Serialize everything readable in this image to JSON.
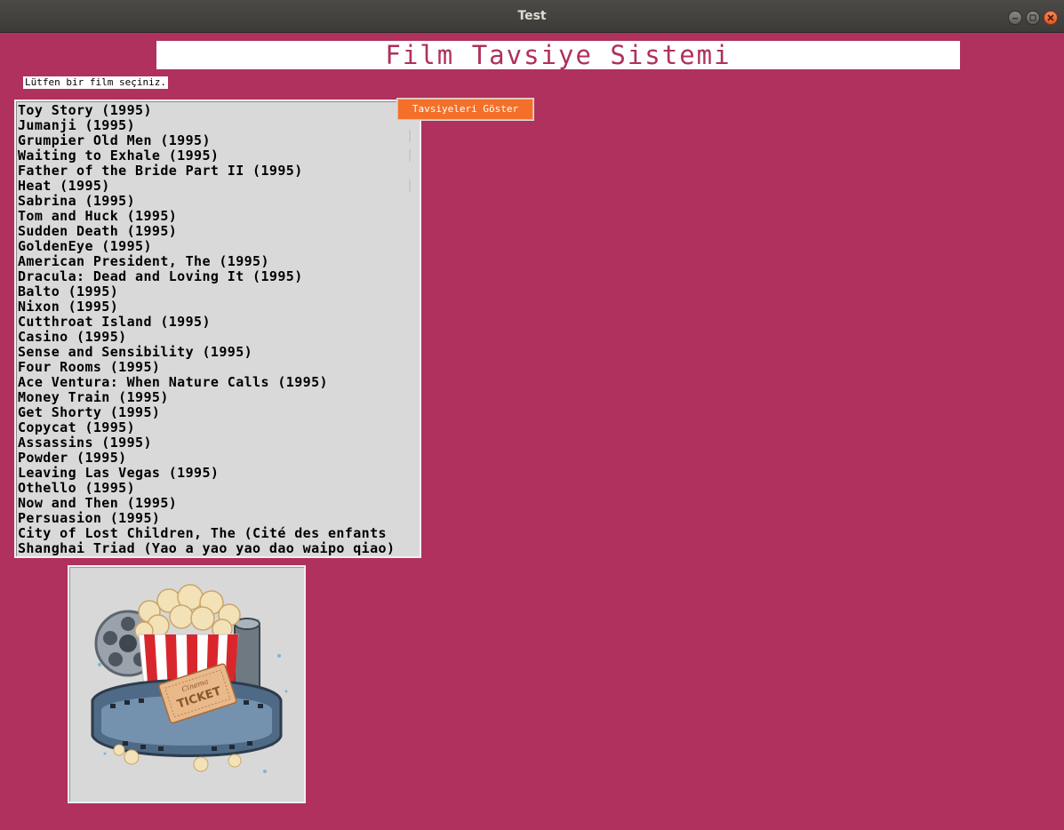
{
  "window": {
    "title": "Test"
  },
  "header": {
    "title": "Film Tavsiye Sistemi"
  },
  "prompt": {
    "label": "Lütfen bir film seçiniz."
  },
  "actions": {
    "show_recommendations": "Tavsiyeleri Göster"
  },
  "movies": [
    "Toy Story (1995)",
    "Jumanji (1995)",
    "Grumpier Old Men (1995)",
    "Waiting to Exhale (1995)",
    "Father of the Bride Part II (1995)",
    "Heat (1995)",
    "Sabrina (1995)",
    "Tom and Huck (1995)",
    "Sudden Death (1995)",
    "GoldenEye (1995)",
    "American President, The (1995)",
    "Dracula: Dead and Loving It (1995)",
    "Balto (1995)",
    "Nixon (1995)",
    "Cutthroat Island (1995)",
    "Casino (1995)",
    "Sense and Sensibility (1995)",
    "Four Rooms (1995)",
    "Ace Ventura: When Nature Calls (1995)",
    "Money Train (1995)",
    "Get Shorty (1995)",
    "Copycat (1995)",
    "Assassins (1995)",
    "Powder (1995)",
    "Leaving Las Vegas (1995)",
    "Othello (1995)",
    "Now and Then (1995)",
    "Persuasion (1995)",
    "City of Lost Children, The (Cité des enfants",
    "Shanghai Triad (Yao a yao yao dao waipo qiao)"
  ],
  "illustration": {
    "icon": "popcorn-film-ticket-illustration",
    "ticket_text": "TICKET",
    "ticket_script": "Cinema"
  },
  "colors": {
    "background": "#b0305e",
    "accent": "#f4702a",
    "list_bg": "#d9d9d9"
  }
}
